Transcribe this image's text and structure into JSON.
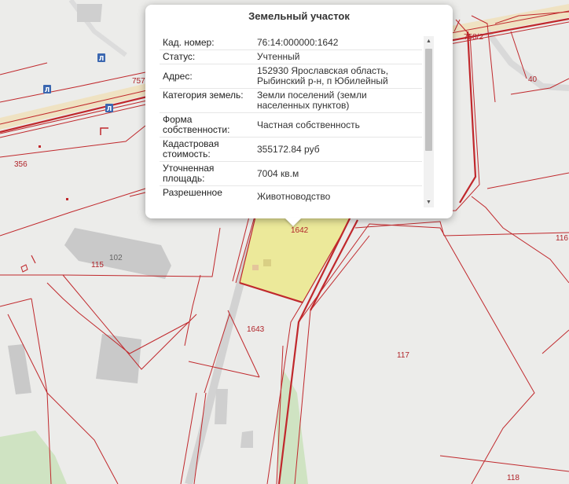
{
  "map": {
    "plot_labels": [
      "356",
      "757",
      "758/2",
      "40",
      "115",
      "1642",
      "1643",
      "117",
      "116",
      "118"
    ],
    "building_labels": [
      "102"
    ],
    "bus_stop_glyph": "Л",
    "colors": {
      "background": "#ececea",
      "boundary": "#c0282c",
      "selected_fill": "#ece99a",
      "building": "#c9c9c9",
      "road_band": "#efe2c2",
      "greenery": "#cfe3c2"
    }
  },
  "popup": {
    "title": "Земельный участок",
    "close_icon": "close-icon",
    "rows": [
      {
        "key": "Кад. номер:",
        "value": "76:14:000000:1642"
      },
      {
        "key": "Статус:",
        "value": "Учтенный"
      },
      {
        "key": "Адрес:",
        "value": "152930 Ярославская область, Рыбинский р-н, п Юбилейный"
      },
      {
        "key": "Категория земель:",
        "value": "Земли поселений (земли населенных пунктов)"
      },
      {
        "key": "Форма собственности:",
        "value": "Частная собственность"
      },
      {
        "key": "Кадастровая стоимость:",
        "value": "355172.84 руб"
      },
      {
        "key": "Уточненная площадь:",
        "value": "7004 кв.м"
      },
      {
        "key": "Разрешенное",
        "value": "Животноводство"
      }
    ]
  }
}
